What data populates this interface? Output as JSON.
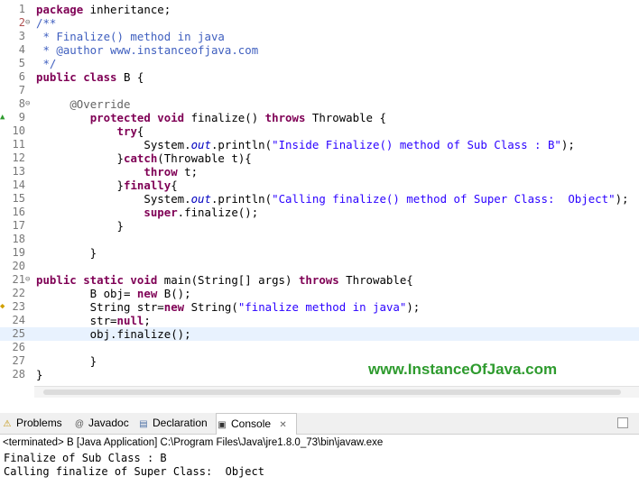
{
  "editor": {
    "lines": [
      {
        "n": "1",
        "html": "<span class='kw'>package</span> inheritance;"
      },
      {
        "n": "2",
        "html": "<span class='cm'>/**</span>"
      },
      {
        "n": "3",
        "html": "<span class='cm'> * Finalize() method in java</span>"
      },
      {
        "n": "4",
        "html": "<span class='cm'> * @author www.instanceofjava.com</span>"
      },
      {
        "n": "5",
        "html": "<span class='cm'> */</span>"
      },
      {
        "n": "6",
        "html": "<span class='kw'>public class</span> B {"
      },
      {
        "n": "7",
        "html": ""
      },
      {
        "n": "8",
        "html": "     <span class='ann'>@Override</span>"
      },
      {
        "n": "9",
        "html": "        <span class='kw'>protected void</span> finalize() <span class='kw'>throws</span> Throwable {"
      },
      {
        "n": "10",
        "html": "            <span class='kw'>try</span>{"
      },
      {
        "n": "11",
        "html": "                System.<span class='it'>out</span>.println(<span class='str'>\"Inside Finalize() method of Sub Class : B\"</span>);"
      },
      {
        "n": "12",
        "html": "            }<span class='kw'>catch</span>(Throwable t){"
      },
      {
        "n": "13",
        "html": "                <span class='kw'>throw</span> t;"
      },
      {
        "n": "14",
        "html": "            }<span class='kw'>finally</span>{"
      },
      {
        "n": "15",
        "html": "                System.<span class='it'>out</span>.println(<span class='str'>\"Calling finalize() method of Super Class:  Object\"</span>);"
      },
      {
        "n": "16",
        "html": "                <span class='kw'>super</span>.finalize();"
      },
      {
        "n": "17",
        "html": "            }"
      },
      {
        "n": "18",
        "html": ""
      },
      {
        "n": "19",
        "html": "        }"
      },
      {
        "n": "20",
        "html": ""
      },
      {
        "n": "21",
        "html": "<span class='kw'>public static void</span> main(String[] args) <span class='kw'>throws</span> Throwable{"
      },
      {
        "n": "22",
        "html": "        B obj= <span class='kw'>new</span> B();"
      },
      {
        "n": "23",
        "html": "        String str=<span class='kw'>new</span> String(<span class='str'>\"finalize method in java\"</span>);"
      },
      {
        "n": "24",
        "html": "        str=<span class='kw'>null</span>;"
      },
      {
        "n": "25",
        "html": "        obj.finalize();"
      },
      {
        "n": "26",
        "html": ""
      },
      {
        "n": "27",
        "html": "        }"
      },
      {
        "n": "28",
        "html": "}"
      }
    ],
    "watermark": "www.InstanceOfJava.com"
  },
  "panel": {
    "tabs": [
      {
        "label": "Problems",
        "icon": "problems-icon",
        "glyph": "⚠"
      },
      {
        "label": "Javadoc",
        "icon": "javadoc-icon",
        "glyph": "@"
      },
      {
        "label": "Declaration",
        "icon": "declaration-icon",
        "glyph": "▤"
      },
      {
        "label": "Console",
        "icon": "console-icon",
        "glyph": "▣",
        "close": "✕"
      }
    ],
    "terminated": "<terminated> B [Java Application] C:\\Program Files\\Java\\jre1.8.0_73\\bin\\javaw.exe",
    "output": [
      "Finalize of Sub Class : B",
      "Calling finalize of Super Class:  Object"
    ]
  },
  "colors": {
    "keyword": "#7f0055",
    "string": "#2a00ff",
    "comment": "#3f5fbf",
    "watermark": "#2e9b2e"
  }
}
